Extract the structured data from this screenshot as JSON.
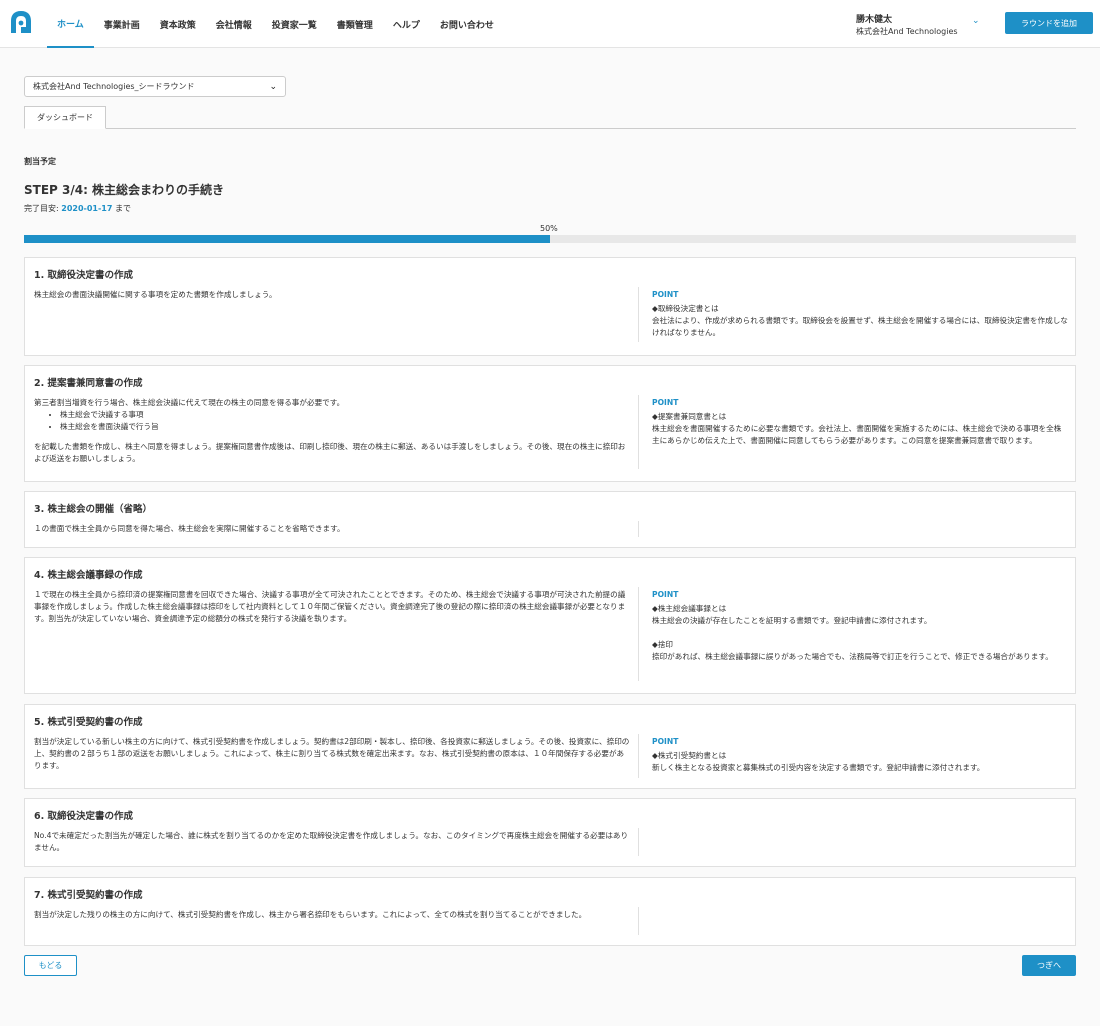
{
  "header": {
    "nav": [
      "ホーム",
      "事業計画",
      "資本政策",
      "会社情報",
      "投資家一覧",
      "書類管理",
      "ヘルプ",
      "お問い合わせ"
    ],
    "user_name": "勝木健太",
    "user_company": "株式会社And Technologies",
    "add_round_label": "ラウンドを追加",
    "accent_color": "#1e90c7"
  },
  "round_select": {
    "value": "株式会社And Technologies_シードラウンド"
  },
  "tabs": [
    "ダッシュボード"
  ],
  "section_label": "割当予定",
  "step_title": "STEP 3/4: 株主総会まわりの手続き",
  "deadline": {
    "prefix": "完了目安:",
    "date": "2020-01-17",
    "suffix": "まで"
  },
  "progress": {
    "label": "50%",
    "value": 0.5
  },
  "cards": [
    {
      "title": "1. 取締役決定書の作成",
      "body": "株主総会の書面決議開催に関する事項を定めた書類を作成しましょう。",
      "point_label": "POINT",
      "points": [
        {
          "heading": "◆取締役決定書とは",
          "text": "会社法により、作成が求められる書類です。取締役会を設置せず、株主総会を開催する場合には、取締役決定書を作成しなければなりません。"
        }
      ]
    },
    {
      "title": "2. 提案書兼同意書の作成",
      "body_intro": "第三者割当増資を行う場合、株主総会決議に代えて現在の株主の同意を得る事が必要です。",
      "bullets": [
        "株主総会で決議する事項",
        "株主総会を書面決議で行う旨"
      ],
      "body_after": "を記載した書類を作成し、株主へ同意を得ましょう。提案権同意書作成後は、印刷し捺印後、現在の株主に郵送、あるいは手渡しをしましょう。その後、現在の株主に捺印および返送をお願いしましょう。",
      "point_label": "POINT",
      "points": [
        {
          "heading": "◆提案書兼同意書とは",
          "text": "株主総会を書面開催するために必要な書類です。会社法上、書面開催を実施するためには、株主総会で決める事項を全株主にあらかじめ伝えた上で、書面開催に同意してもらう必要があります。この同意を提案書兼同意書で取ります。"
        }
      ]
    },
    {
      "title": "3. 株主総会の開催（省略）",
      "body": "１の書面で株主全員から同意を得た場合、株主総会を実際に開催することを省略できます。"
    },
    {
      "title": "4. 株主総会議事録の作成",
      "body": "１で現在の株主全員から捺印済の提案権同意書を回収できた場合、決議する事項が全て可決されたこととできます。そのため、株主総会で決議する事項が可決された前提の議事録を作成しましょう。作成した株主総会議事録は捺印をして社内資料として１０年間ご保管ください。資金調達完了後の登記の際に捺印済の株主総会議事録が必要となります。割当先が決定していない場合、資金調達予定の総額分の株式を発行する決議を執ります。",
      "point_label": "POINT",
      "points": [
        {
          "heading": "◆株主総会議事録とは",
          "text": "株主総会の決議が存在したことを証明する書類です。登記申請書に添付されます。"
        },
        {
          "heading": "◆捨印",
          "text": "捺印があれば、株主総会議事録に誤りがあった場合でも、法務局等で訂正を行うことで、修正できる場合があります。"
        }
      ]
    },
    {
      "title": "5. 株式引受契約書の作成",
      "body": "割当が決定している新しい株主の方に向けて、株式引受契約書を作成しましょう。契約書は2部印刷・製本し、捺印後、各投資家に郵送しましょう。その後、投資家に、捺印の上、契約書の２部うち１部の返送をお願いしましょう。これによって、株主に割り当てる株式数を確定出来ます。なお、株式引受契約書の原本は、１０年間保存する必要があります。",
      "point_label": "POINT",
      "points": [
        {
          "heading": "◆株式引受契約書とは",
          "text": "新しく株主となる投資家と募集株式の引受内容を決定する書類です。登記申請書に添付されます。"
        }
      ]
    },
    {
      "title": "6. 取締役決定書の作成",
      "body": "No.4で未確定だった割当先が確定した場合、誰に株式を割り当てるのかを定めた取締役決定書を作成しましょう。なお、このタイミングで再度株主総会を開催する必要はありません。"
    },
    {
      "title": "7. 株式引受契約書の作成",
      "body": "割当が決定した残りの株主の方に向けて、株式引受契約書を作成し、株主から署名捺印をもらいます。これによって、全ての株式を割り当てることができました。"
    }
  ],
  "footer": {
    "back_label": "もどる",
    "next_label": "つぎへ"
  }
}
